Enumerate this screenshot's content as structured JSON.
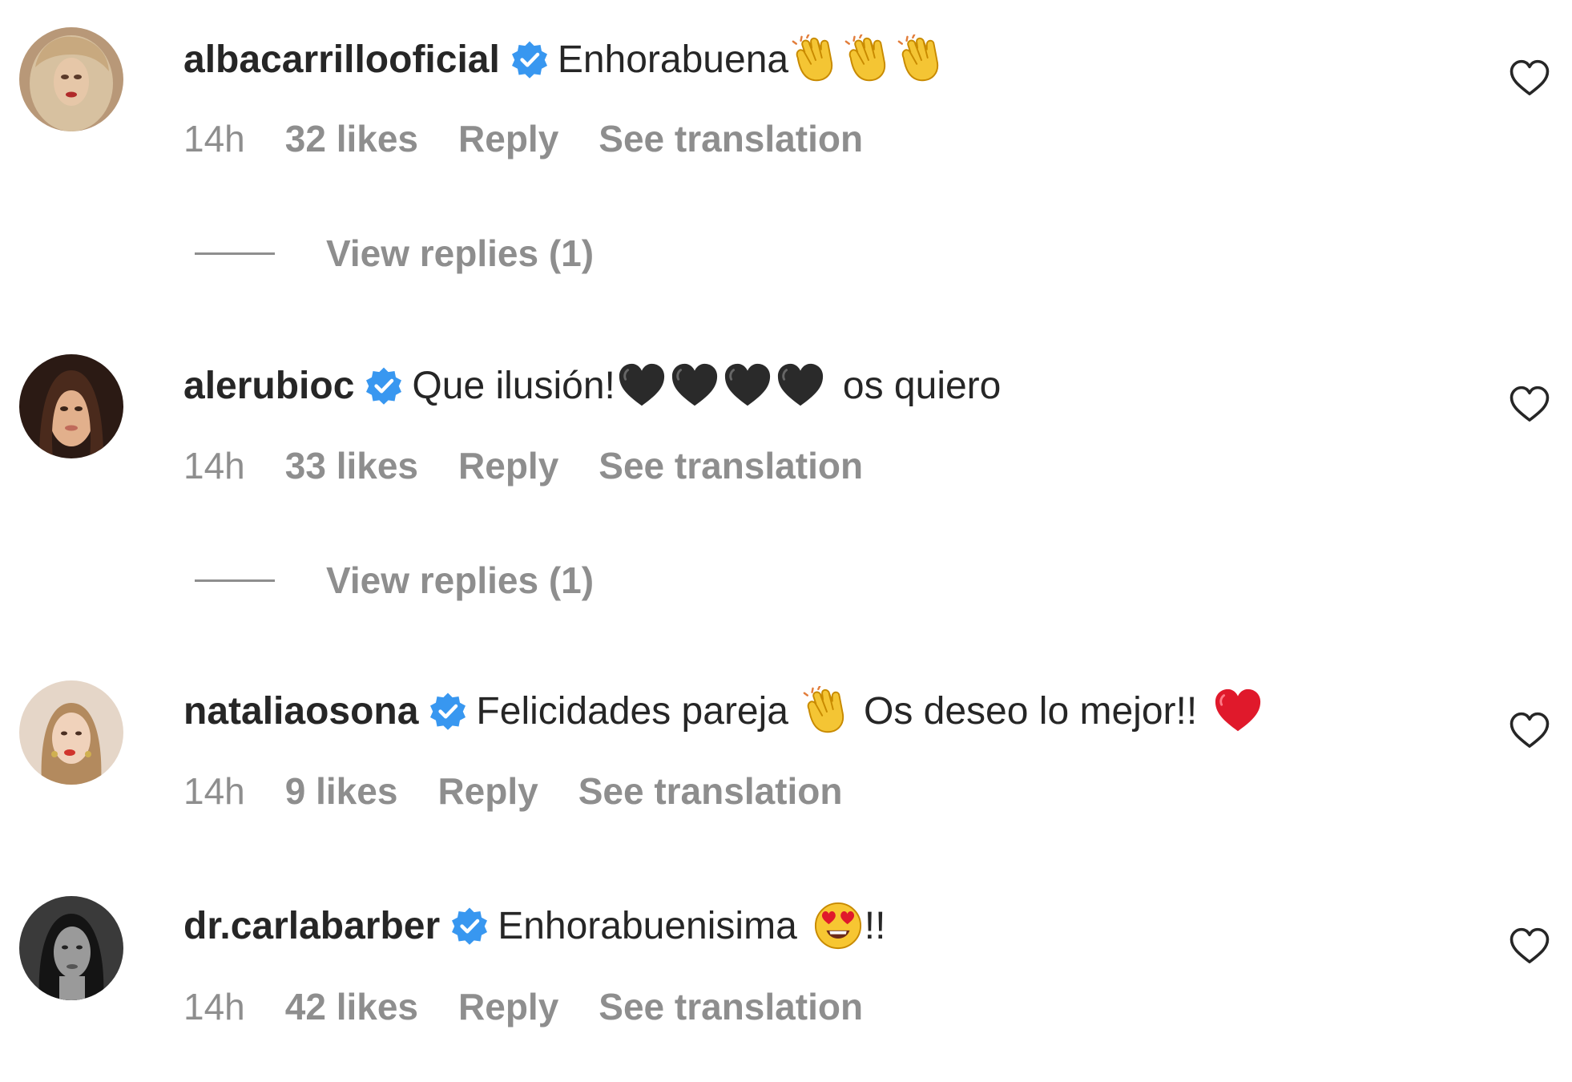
{
  "comments": [
    {
      "username": "albacarrillooficial",
      "text_before": "Enhorabuena",
      "emojis": [
        "clap-emoji",
        "clap-emoji",
        "clap-emoji"
      ],
      "text_after": "",
      "time": "14h",
      "likes": "32 likes",
      "reply": "Reply",
      "translate": "See translation",
      "view_replies": "View replies (1)"
    },
    {
      "username": "alerubioc",
      "text_before": "Que ilusión!",
      "emojis": [
        "black-heart-emoji",
        "black-heart-emoji",
        "black-heart-emoji",
        "black-heart-emoji"
      ],
      "text_after": "os quiero",
      "time": "14h",
      "likes": "33 likes",
      "reply": "Reply",
      "translate": "See translation",
      "view_replies": "View replies (1)"
    },
    {
      "username": "nataliaosona",
      "text_before": "Felicidades pareja",
      "emojis": [
        "clap-emoji"
      ],
      "text_middle": "Os deseo lo mejor!!",
      "emojis_after": [
        "red-heart-emoji"
      ],
      "time": "14h",
      "likes": "9 likes",
      "reply": "Reply",
      "translate": "See translation"
    },
    {
      "username": "dr.carlabarber",
      "text_before": "Enhorabuenisima",
      "emojis": [
        "heart-eyes-emoji"
      ],
      "text_after": "!!",
      "time": "14h",
      "likes": "42 likes",
      "reply": "Reply",
      "translate": "See translation"
    }
  ],
  "colors": {
    "text": "#262626",
    "secondary": "#8e8e8e",
    "verified": "#3897f0"
  },
  "icons": {
    "verified": "verified-badge-icon",
    "like": "heart-outline-icon"
  }
}
